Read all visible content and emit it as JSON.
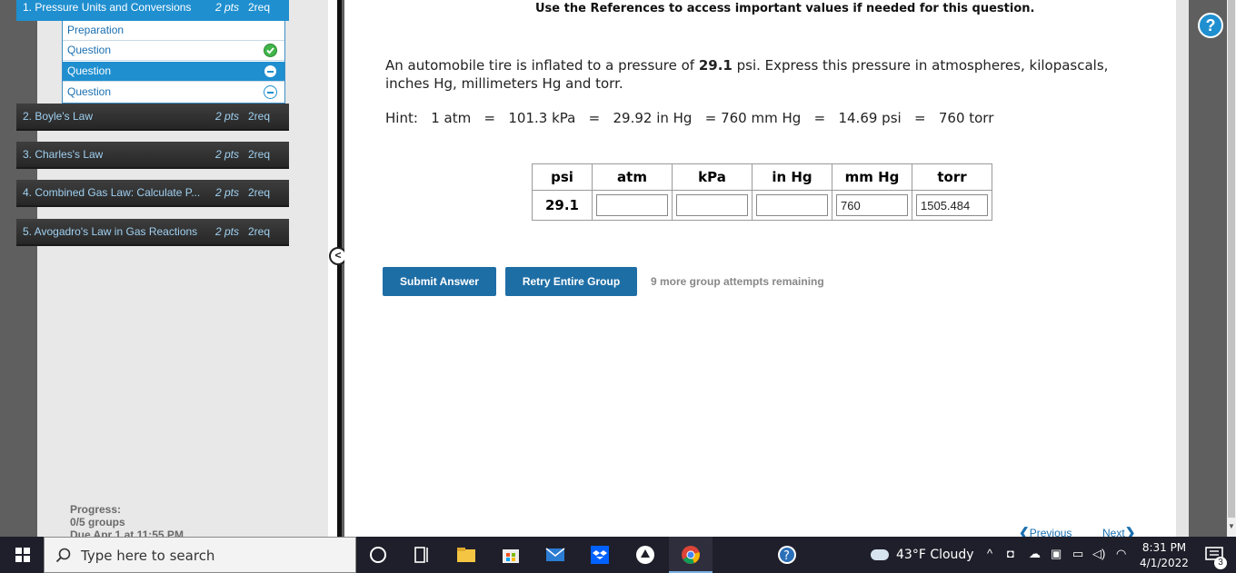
{
  "sidebar": {
    "groups": [
      {
        "title": "1. Pressure Units and Conversions",
        "pts": "2 pts",
        "req": "2req"
      },
      {
        "title": "2. Boyle's Law",
        "pts": "2 pts",
        "req": "2req"
      },
      {
        "title": "3. Charles's Law",
        "pts": "2 pts",
        "req": "2req"
      },
      {
        "title": "4. Combined Gas Law: Calculate P...",
        "pts": "2 pts",
        "req": "2req"
      },
      {
        "title": "5. Avogadro's Law in Gas Reactions",
        "pts": "2 pts",
        "req": "2req"
      }
    ],
    "sub_items": [
      {
        "label": "Preparation"
      },
      {
        "label": "Question",
        "status": "check-icon"
      },
      {
        "label": "Question",
        "status": "circle-icon"
      },
      {
        "label": "Question",
        "status": "circle-icon"
      }
    ],
    "progress_label": "Progress:",
    "progress_value": "0/5 groups",
    "due_text": "Due Apr 1 at 11:55 PM",
    "collapse_glyph": "<"
  },
  "main": {
    "references_note": "Use the References to access important values if needed for this question.",
    "question_pre": "An automobile tire is inflated to a pressure of ",
    "question_value": "29.1",
    "question_post": " psi. Express this pressure in atmospheres, kilopascals, inches Hg, millimeters Hg and torr.",
    "hint": "Hint:   1 atm   =   101.3 kPa   =   29.92 in Hg   = 760 mm Hg   =   14.69 psi   =   760 torr",
    "table": {
      "headers": [
        "psi",
        "atm",
        "kPa",
        "in Hg",
        "mm Hg",
        "torr"
      ],
      "given": "29.1",
      "inputs": {
        "atm": "",
        "kpa": "",
        "inhg": "",
        "mmhg": "760",
        "torr": "1505.484"
      }
    },
    "submit_label": "Submit Answer",
    "retry_label": "Retry Entire Group",
    "attempts_text": "9 more group attempts remaining",
    "previous_label": "Previous",
    "next_label": "Next",
    "help_glyph": "?"
  },
  "taskbar": {
    "search_placeholder": "Type here to search",
    "weather": "43°F  Cloudy",
    "time": "8:31 PM",
    "date": "4/1/2022",
    "notification_count": "3"
  },
  "colors": {
    "accent": "#1f8fd0",
    "button": "#1e6ea6",
    "taskbar": "#1f1f2b"
  }
}
